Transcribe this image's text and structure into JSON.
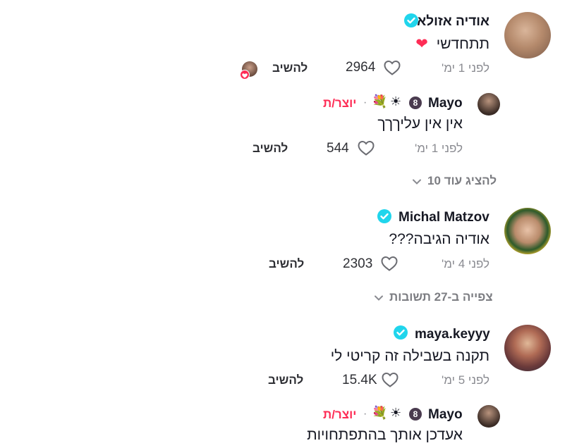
{
  "colors": {
    "verified": "#20d5ec",
    "creator": "#fe2c55",
    "muted": "#8a8b91",
    "heart_badge": "#fe2c55"
  },
  "comments": [
    {
      "username": "אודיה אזולאי",
      "verified": true,
      "text": "תתחדשי",
      "emoji": "❤",
      "time": "לפני 1 ימ'",
      "likes": "2964",
      "reply": "להשיב"
    },
    {
      "username": "Mayo",
      "badges": [
        "🌼",
        "☀",
        "💐"
      ],
      "separator": "·",
      "creator_label": "יוצר/ת",
      "text": "אין אין עליךךך",
      "time": "לפני 1 ימ'",
      "likes": "544",
      "reply": "להשיב"
    },
    {
      "view_more": "להציג עוד 10"
    },
    {
      "username": "Michal Matzov",
      "verified": true,
      "text": "אודיה הגיבה???",
      "time": "לפני 4 ימ'",
      "likes": "2303",
      "reply": "להשיב"
    },
    {
      "view_replies": "צפייה ב-27 תשובות"
    },
    {
      "username": "maya.keyyy",
      "verified": true,
      "text": "תקנה בשבילה זה קריטי לי",
      "time": "לפני 5 ימ'",
      "likes": "15.4K",
      "reply": "להשיב"
    },
    {
      "username": "Mayo",
      "badges": [
        "🌼",
        "☀",
        "💐"
      ],
      "separator": "·",
      "creator_label": "יוצר/ת",
      "text": "אעדכן אותך בהתפתחויות"
    }
  ]
}
